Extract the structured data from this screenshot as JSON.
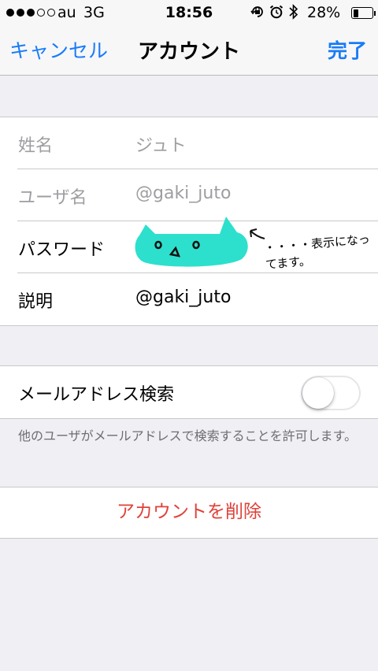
{
  "status_bar": {
    "signal_bars": 5,
    "signal_filled": 3,
    "carrier": "au",
    "network": "3G",
    "time": "18:56",
    "icons": [
      "orientation-lock-icon",
      "alarm-icon",
      "bluetooth-icon"
    ],
    "battery_percent": "28%",
    "battery_level": 0.28
  },
  "nav": {
    "cancel_label": "キャンセル",
    "title": "アカウント",
    "done_label": "完了",
    "accent_color": "#1a7cf7"
  },
  "account": {
    "rows": [
      {
        "label": "姓名",
        "value": "ジュト"
      },
      {
        "label": "ユーザ名",
        "value": "@gaki_juto"
      },
      {
        "label": "パスワード",
        "value": ""
      },
      {
        "label": "説明",
        "value": "@gaki_juto"
      }
    ]
  },
  "annotation": {
    "text": "・・・・表示になってます。",
    "color": "#000000"
  },
  "email_search": {
    "label": "メールアドレス検索",
    "enabled": false,
    "footnote": "他のユーザがメールアドレスで検索することを許可します。"
  },
  "delete": {
    "label": "アカウントを削除",
    "color": "#e0423a"
  }
}
